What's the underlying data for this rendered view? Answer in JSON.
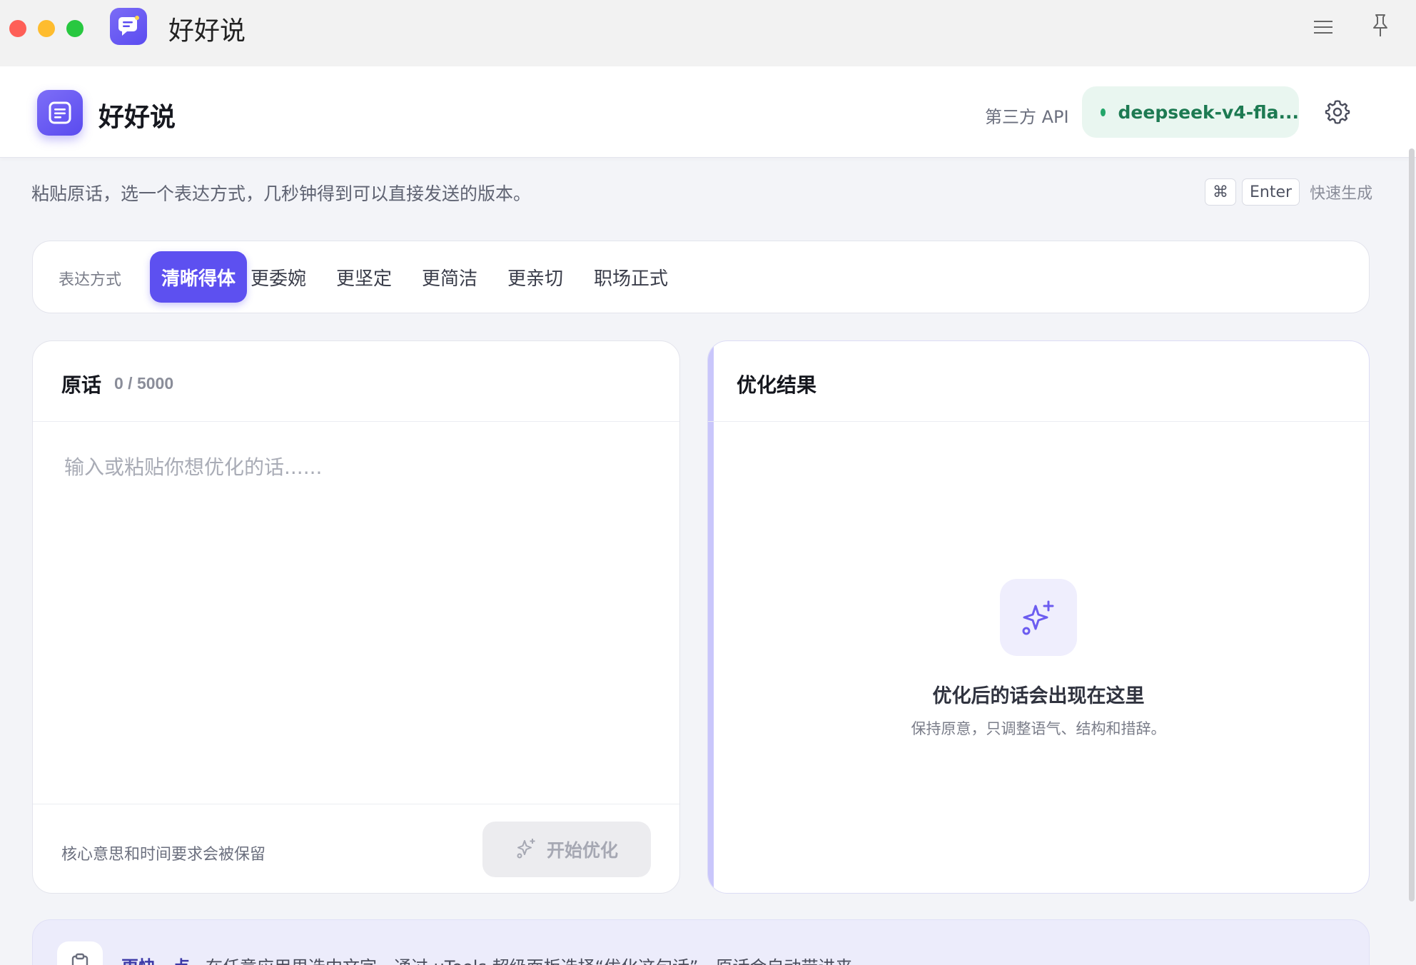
{
  "window": {
    "title": "好好说"
  },
  "header": {
    "app_name": "好好说",
    "provider_label": "第三方 API",
    "model_name": "deepseek-v4-fla...",
    "model_status_color": "#23a66a",
    "accent_color": "#5d50f0"
  },
  "intro": {
    "subtitle": "粘贴原话，选一个表达方式，几秒钟得到可以直接发送的版本。",
    "shortcut_keys": [
      "⌘",
      "Enter"
    ],
    "shortcut_label": "快速生成"
  },
  "styles": {
    "label": "表达方式",
    "tabs": [
      {
        "label": "清晰得体",
        "active": true
      },
      {
        "label": "更委婉",
        "active": false
      },
      {
        "label": "更坚定",
        "active": false
      },
      {
        "label": "更简洁",
        "active": false
      },
      {
        "label": "更亲切",
        "active": false
      },
      {
        "label": "职场正式",
        "active": false
      }
    ]
  },
  "source_panel": {
    "title": "原话",
    "count": "0 / 5000",
    "placeholder": "输入或粘贴你想优化的话......",
    "value": "",
    "footer_note": "核心意思和时间要求会被保留",
    "start_button": "开始优化"
  },
  "result_panel": {
    "title": "优化结果",
    "empty_title": "优化后的话会出现在这里",
    "empty_desc": "保持原意，只调整语气、结构和措辞。"
  },
  "tip": {
    "strong": "更快一点",
    "text": "在任意应用里选中文字，通过 uTools 超级面板选择“优化这句话”，原话会自动带进来。"
  },
  "icons": {
    "app": "chat-bubble-icon",
    "menu": "menu-icon",
    "pin": "pin-icon",
    "settings": "gear-icon",
    "sparkle": "sparkle-icon",
    "clipboard": "clipboard-icon"
  }
}
